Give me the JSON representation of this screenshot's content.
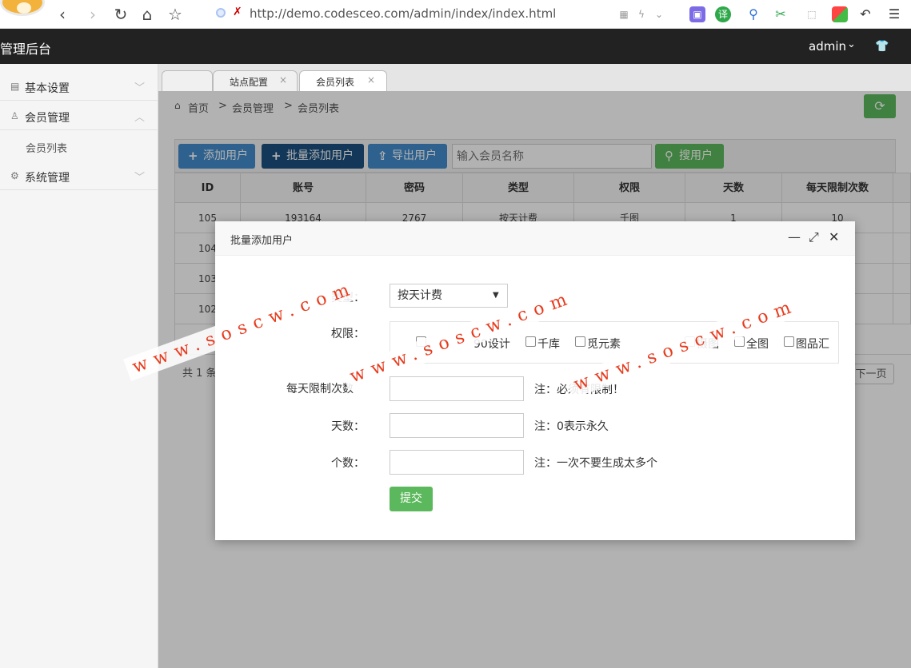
{
  "browser": {
    "url": "http://demo.codesceo.com/admin/index/index.html"
  },
  "header": {
    "title": "管理后台",
    "user": "admin"
  },
  "sidebar": {
    "items": [
      {
        "label": "基本设置"
      },
      {
        "label": "会员管理"
      },
      {
        "label": "会员列表"
      },
      {
        "label": "系统管理"
      }
    ]
  },
  "tabs": [
    {
      "label": ""
    },
    {
      "label": "站点配置"
    },
    {
      "label": "会员列表"
    }
  ],
  "breadcrumb": [
    "首页",
    ">",
    "会员管理",
    ">",
    "会员列表"
  ],
  "toolbar": {
    "add": "添加用户",
    "batch_add": "批量添加用户",
    "export": "导出用户",
    "search_placeholder": "输入会员名称",
    "search": "搜用户"
  },
  "table": {
    "headers": [
      "ID",
      "账号",
      "密码",
      "类型",
      "权限",
      "天数",
      "每天限制次数"
    ],
    "rows": [
      [
        "105",
        "193164",
        "2767",
        "按天计费",
        "千图",
        "1",
        "10"
      ],
      [
        "104",
        "",
        "",
        "",
        "",
        "",
        ""
      ],
      [
        "103",
        "",
        "",
        "",
        "",
        "",
        ""
      ],
      [
        "102",
        "",
        "",
        "",
        "",
        "",
        ""
      ]
    ]
  },
  "pagination": {
    "info": "共 1 条",
    "next": "下一页"
  },
  "modal": {
    "title": "批量添加用户",
    "type_label": "类型：",
    "type_value": "按天计费",
    "perm_label": "权限：",
    "perms": [
      "90设计",
      "千库",
      "觅元素",
      "摄图",
      "全图",
      "图品汇"
    ],
    "daily_label": "每天限制次数",
    "daily_note": "注：必须有限制！",
    "days_label": "天数：",
    "days_note": "注：0表示永久",
    "count_label": "个数：",
    "count_note": "注：一次不要生成太多个",
    "submit": "提交"
  },
  "watermark": "www.soscw.com"
}
